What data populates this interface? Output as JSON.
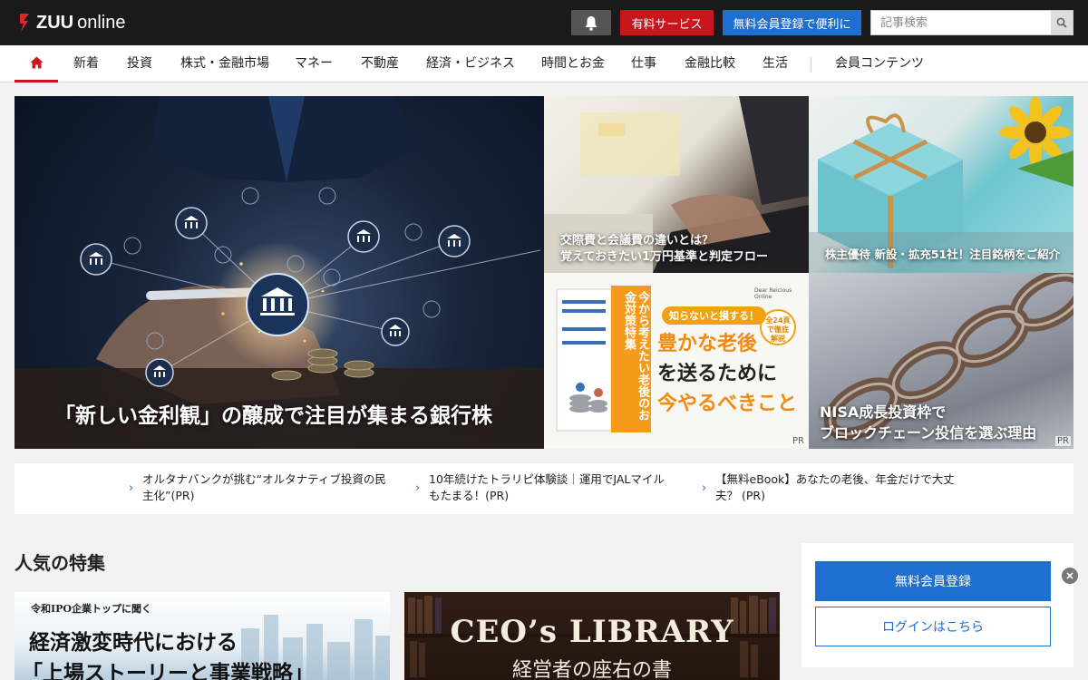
{
  "header": {
    "logo_brand": "ZUU",
    "logo_suffix": "online",
    "paid_service": "有料サービス",
    "free_register_cta": "無料会員登録で便利に",
    "search_placeholder": "記事検索"
  },
  "nav": {
    "items": [
      "新着",
      "投資",
      "株式・金融市場",
      "マネー",
      "不動産",
      "経済・ビジネス",
      "時間とお金",
      "仕事",
      "金融比較",
      "生活",
      "会員コンテンツ"
    ]
  },
  "hero": {
    "main_title": "「新しい金利観」の醸成で注目が集まる銀行株",
    "tile_a_line1": "交際費と会議費の違いとは？",
    "tile_a_line2": "覚えておきたい1万円基準と判定フロー",
    "tile_b_title": "株主優待 新設・拡充51社！注目銘柄をご紹介",
    "tile_c": {
      "badge": "知らないと損する！",
      "line1": "豊かな老後",
      "line2": "を送るために",
      "line3": "今やるべきこと",
      "circle_badge": "全24頁で徹底解説",
      "book_title": "今から考えたい老後のお金対策特集",
      "publisher": "Dear Reicious Online",
      "pr": "PR"
    },
    "tile_d_line1": "NISA成長投資枠で",
    "tile_d_line2": "ブロックチェーン投信を選ぶ理由",
    "tile_d_pr": "PR"
  },
  "links": [
    {
      "line1": "オルタナバンクが挑む“オルタナティブ投資の民",
      "line2": "主化”(PR)"
    },
    {
      "line1": "10年続けたトラリピ体験談｜運用でJALマイル",
      "line2": "もたまる！(PR)"
    },
    {
      "line1": "【無料eBook】あなたの老後、年金だけで大丈",
      "line2": "夫？ (PR)"
    }
  ],
  "features": {
    "section_title": "人気の特集",
    "a_kicker": "令和IPO企業トップに聞く",
    "a_line1": "経済激変時代における",
    "a_line2": "「上場ストーリーと事業戦略」",
    "b_title": "CEO’s LIBRARY",
    "b_subtitle": "経営者の座右の書"
  },
  "login_panel": {
    "register_label": "無料会員登録",
    "login_label": "ログインはこちら"
  },
  "colors": {
    "accent_red": "#c8161d",
    "accent_blue": "#1e6fd0",
    "header_bg": "#1a1a1a"
  }
}
